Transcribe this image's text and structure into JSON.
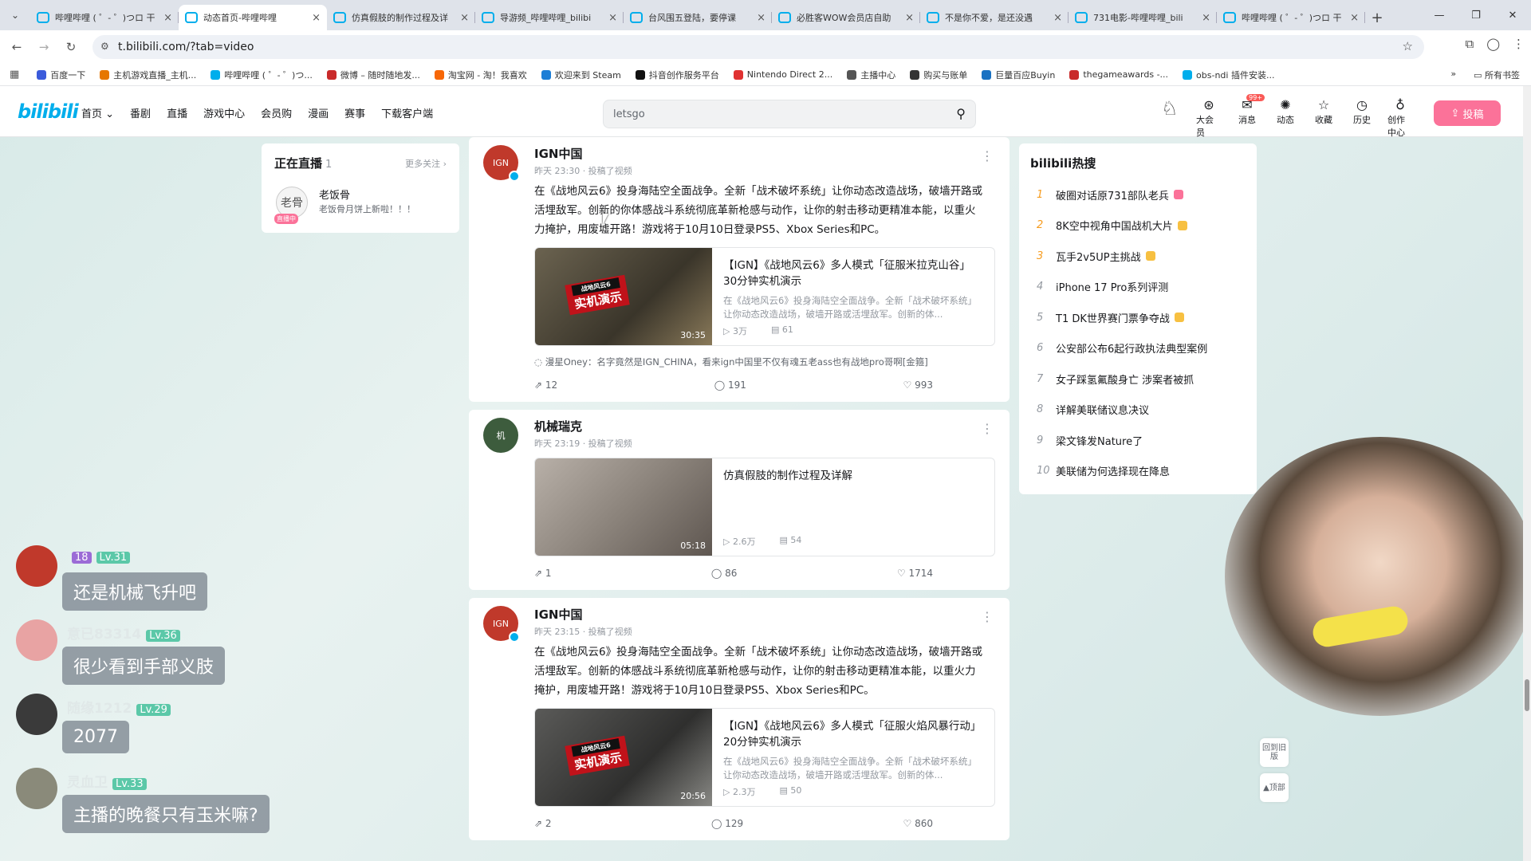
{
  "browser": {
    "tabs": [
      {
        "title": "哔哩哔哩 ( ゜- ゜)つロ 干",
        "active": false
      },
      {
        "title": "动态首页-哔哩哔哩",
        "active": true
      },
      {
        "title": "仿真假肢的制作过程及详",
        "active": false
      },
      {
        "title": "导游频_哔哩哔哩_bilibi",
        "active": false
      },
      {
        "title": "台风围五登陆，要停课",
        "active": false
      },
      {
        "title": "必胜客WOW会员店自助",
        "active": false
      },
      {
        "title": "不是你不爱，是还没遇",
        "active": false
      },
      {
        "title": "731电影-哔哩哔哩_bili",
        "active": false
      },
      {
        "title": "哔哩哔哩 ( ゜- ゜)つロ 干",
        "active": false
      }
    ],
    "url": "t.bilibili.com/?tab=video",
    "bookmarks": [
      "百度一下",
      "主机游戏直播_主机...",
      "哔哩哔哩 ( ゜- ゜)つ...",
      "微博 – 随时随地发...",
      "淘宝网 - 淘！我喜欢",
      "欢迎来到 Steam",
      "抖音创作服务平台",
      "Nintendo Direct 2...",
      "主播中心",
      "购买与账单",
      "巨量百应Buyin",
      "thegameawards -...",
      "obs-ndi 插件安装..."
    ],
    "bookmarks_more": "所有书签",
    "bookmark_colors": [
      "#3b5bdb",
      "#e67700",
      "#00aeec",
      "#c92a2a",
      "#f76707",
      "#1c7ed6",
      "#111111",
      "#e03131",
      "#555555",
      "#333333",
      "#1971c2",
      "#c92a2a",
      "#00aeec"
    ]
  },
  "header": {
    "logo": "bilibili",
    "nav": [
      "首页",
      "番剧",
      "直播",
      "游戏中心",
      "会员购",
      "漫画",
      "赛事",
      "下载客户端"
    ],
    "search_placeholder": "letsgo",
    "icons": [
      {
        "label": "大会员",
        "icon": "vip-icon",
        "glyph": "⊛"
      },
      {
        "label": "消息",
        "icon": "message-icon",
        "glyph": "✉",
        "badge": "99+"
      },
      {
        "label": "动态",
        "icon": "dynamic-icon",
        "glyph": "✺"
      },
      {
        "label": "收藏",
        "icon": "favorite-icon",
        "glyph": "☆"
      },
      {
        "label": "历史",
        "icon": "history-icon",
        "glyph": "◷"
      },
      {
        "label": "创作中心",
        "icon": "creator-icon",
        "glyph": "♁"
      }
    ],
    "upload": "投稿"
  },
  "live": {
    "title": "正在直播",
    "count": "1",
    "more": "更多关注",
    "streamer": "老饭骨",
    "desc": "老饭骨月饼上新啦！！！",
    "tag": "直播中",
    "avatar_text": "老骨"
  },
  "feed": [
    {
      "author": "IGN中国",
      "time": "昨天 23:30 · 投稿了视频",
      "avatar_text": "IGN",
      "text": "在《战地风云6》投身海陆空全面战争。全新「战术破坏系统」让你动态改造战场，破墙开路或活埋敌军。创新的你体感战斗系统彻底革新枪感与动作，让你的射击移动更精准本能，以重火力掩护，用废墟开路！游戏将于10月10日登录PS5、Xbox Series和PC。",
      "video_title": "【IGN】《战地风云6》多人模式「征服米拉克山谷」30分钟实机演示",
      "video_desc": "在《战地风云6》投身海陆空全面战争。全新「战术破坏系统」让你动态改造战场，破墙开路或活埋敌军。创新的体...",
      "duration": "30:35",
      "views": "3万",
      "danmaku": "61",
      "stamp": "实机演示",
      "stamp_sub": "战地风云6",
      "comment": "漫星Oney：名字竟然是IGN_CHINA，看来ign中国里不仅有魂五老ass也有战地pro哥啊[金箍]",
      "shares": "12",
      "comments": "191",
      "likes": "993"
    },
    {
      "author": "机械瑞克",
      "time": "昨天 23:19 · 投稿了视频",
      "avatar_text": "机",
      "text": "",
      "video_title": "仿真假肢的制作过程及详解",
      "video_desc": "",
      "duration": "05:18",
      "views": "2.6万",
      "danmaku": "54",
      "comment": "",
      "shares": "1",
      "comments": "86",
      "likes": "1714"
    },
    {
      "author": "IGN中国",
      "time": "昨天 23:15 · 投稿了视频",
      "avatar_text": "IGN",
      "text": "在《战地风云6》投身海陆空全面战争。全新「战术破坏系统」让你动态改造战场，破墙开路或活埋敌军。创新的体感战斗系统彻底革新枪感与动作，让你的射击移动更精准本能，以重火力掩护，用废墟开路！游戏将于10月10日登录PS5、Xbox Series和PC。",
      "video_title": "【IGN】《战地风云6》多人模式「征服火焰风暴行动」20分钟实机演示",
      "video_desc": "在《战地风云6》投身海陆空全面战争。全新「战术破坏系统」让你动态改造战场，破墙开路或活埋敌军。创新的体...",
      "duration": "20:56",
      "views": "2.3万",
      "danmaku": "50",
      "stamp": "实机演示",
      "stamp_sub": "战地风云6",
      "comment": "",
      "shares": "2",
      "comments": "129",
      "likes": "860"
    }
  ],
  "hot": {
    "title": "bilibili热搜",
    "items": [
      {
        "rank": "1",
        "text": "破圈对话原731部队老兵",
        "tag": "#fb7299"
      },
      {
        "rank": "2",
        "text": "8K空中视角中国战机大片",
        "tag": "#f7c041"
      },
      {
        "rank": "3",
        "text": "瓦手2v5UP主挑战",
        "tag": "#f7c041"
      },
      {
        "rank": "4",
        "text": "iPhone 17 Pro系列评测",
        "tag": ""
      },
      {
        "rank": "5",
        "text": "T1 DK世界赛门票争夺战",
        "tag": "#f7c041"
      },
      {
        "rank": "6",
        "text": "公安部公布6起行政执法典型案例",
        "tag": ""
      },
      {
        "rank": "7",
        "text": "女子踩氢氟酸身亡 涉案者被抓",
        "tag": ""
      },
      {
        "rank": "8",
        "text": "详解美联储议息决议",
        "tag": ""
      },
      {
        "rank": "9",
        "text": "梁文锋发Nature了",
        "tag": ""
      },
      {
        "rank": "10",
        "text": "美联储为何选择现在降息",
        "tag": ""
      }
    ]
  },
  "chat": [
    {
      "user": "",
      "level": "Lv.31",
      "medal": "18",
      "message": "还是机械飞升吧",
      "avatar": "#c0392b"
    },
    {
      "user": "意已83314",
      "level": "Lv.36",
      "medal": "",
      "message": "很少看到手部义肢",
      "avatar": "#e8a3a3"
    },
    {
      "user": "随缘1212",
      "level": "Lv.29",
      "medal": "",
      "message": "2077",
      "avatar": "#3a3a3a"
    },
    {
      "user": "灵血卫",
      "level": "Lv.33",
      "medal": "",
      "message": "主播的晚餐只有玉米嘛?",
      "avatar": "#8a8a7a"
    }
  ],
  "side_buttons": [
    "回到旧版",
    "顶部"
  ]
}
